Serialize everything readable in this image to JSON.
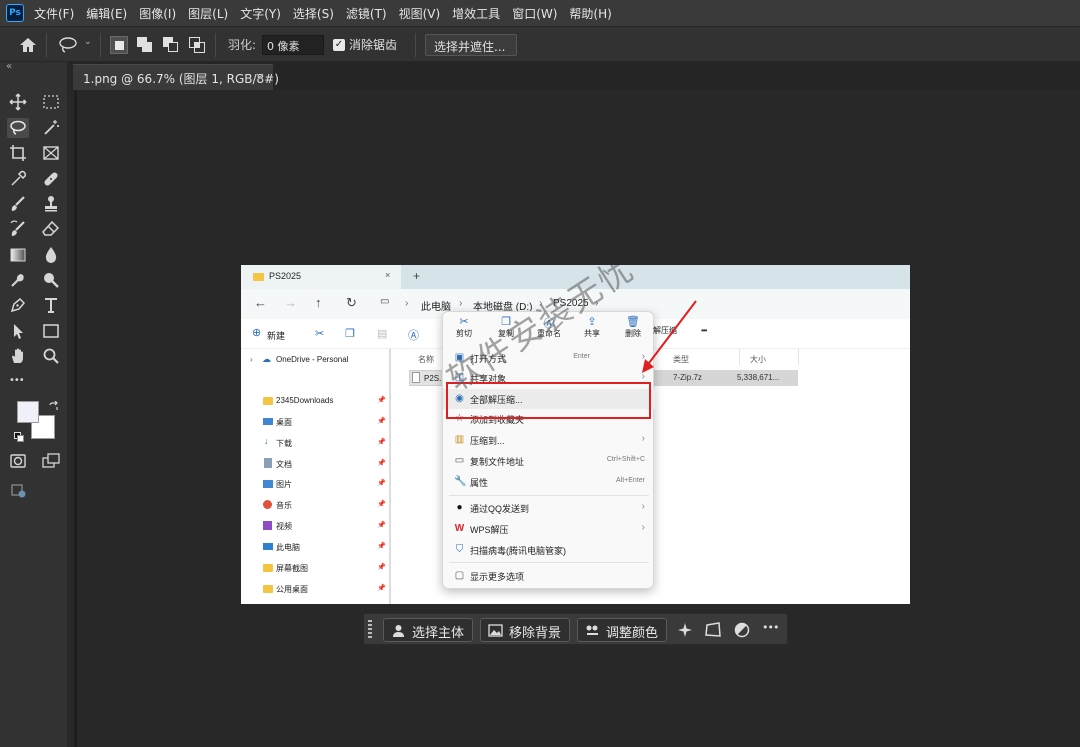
{
  "app": {
    "logo_text": "Ps"
  },
  "menubar": {
    "items": [
      "文件(F)",
      "编辑(E)",
      "图像(I)",
      "图层(L)",
      "文字(Y)",
      "选择(S)",
      "滤镜(T)",
      "视图(V)",
      "增效工具",
      "窗口(W)",
      "帮助(H)"
    ]
  },
  "options": {
    "feather_label": "羽化:",
    "feather_value": "0 像素",
    "antialias_label": "消除锯齿",
    "antialias_checked": true,
    "select_mask_button": "选择并遮住..."
  },
  "toolbar": {
    "collapse_glyph": "«",
    "tools": [
      "move",
      "marquee",
      "lasso",
      "magic-wand",
      "crop",
      "frame",
      "eyedropper",
      "healing",
      "brush",
      "stamp",
      "history-brush",
      "eraser",
      "gradient",
      "blur",
      "dodge",
      "pen",
      "type",
      "path-select",
      "shape",
      "hand",
      "zoom",
      "more"
    ],
    "more_glyph": "•••"
  },
  "document": {
    "tab_title": "1.png @ 66.7% (图层 1, RGB/8#)",
    "close_glyph": "×"
  },
  "explorer": {
    "tab_title": "PS2025",
    "tab_close": "×",
    "new_tab": "+",
    "breadcrumb": [
      "此电脑",
      "本地磁盘 (D:)",
      "PS2025"
    ],
    "new_button": "新建",
    "nav_items": [
      {
        "label": "OneDrive - Personal"
      },
      {
        "label": "2345Downloads"
      },
      {
        "label": "桌面"
      },
      {
        "label": "下载"
      },
      {
        "label": "文档"
      },
      {
        "label": "图片"
      },
      {
        "label": "音乐"
      },
      {
        "label": "视频"
      },
      {
        "label": "此电脑"
      },
      {
        "label": "屏幕截图"
      },
      {
        "label": "公用桌面"
      }
    ],
    "columns": [
      "名称",
      "类型",
      "大小"
    ],
    "file": {
      "name": "P2S...",
      "type": "7-Zip.7z",
      "size": "5,338,671..."
    }
  },
  "context_menu": {
    "top_actions": [
      "剪切",
      "复制",
      "重命名",
      "共享",
      "删除",
      "解压缩"
    ],
    "more_glyph": "•••",
    "items": [
      {
        "label": "打开方式",
        "shortcut": "Enter",
        "arrow": true
      },
      {
        "label": "共享对象",
        "shortcut": "",
        "arrow": true
      },
      {
        "label": "全部解压缩...",
        "shortcut": "",
        "arrow": false
      },
      {
        "label": "添加到收藏夹",
        "shortcut": "",
        "arrow": false
      },
      {
        "label": "压缩到...",
        "shortcut": "",
        "arrow": true
      },
      {
        "label": "复制文件地址",
        "shortcut": "Ctrl+Shift+C",
        "arrow": false
      },
      {
        "label": "属性",
        "shortcut": "Alt+Enter",
        "arrow": false
      },
      {
        "label": "通过QQ发送到",
        "shortcut": "",
        "arrow": true
      },
      {
        "label": "WPS解压",
        "shortcut": "",
        "arrow": true
      },
      {
        "label": "扫描病毒(腾讯电脑管家)",
        "shortcut": "",
        "arrow": false
      },
      {
        "label": "显示更多选项",
        "shortcut": "",
        "arrow": false
      }
    ]
  },
  "watermark": "软件安装无忧",
  "taskbar": {
    "select_subject": "选择主体",
    "remove_background": "移除背景",
    "adjust_color": "调整颜色",
    "more_glyph": "•••"
  },
  "colors": {
    "ps_blue": "#31a8ff",
    "highlight_red": "#e02020",
    "chrome_dark": "#323232"
  }
}
